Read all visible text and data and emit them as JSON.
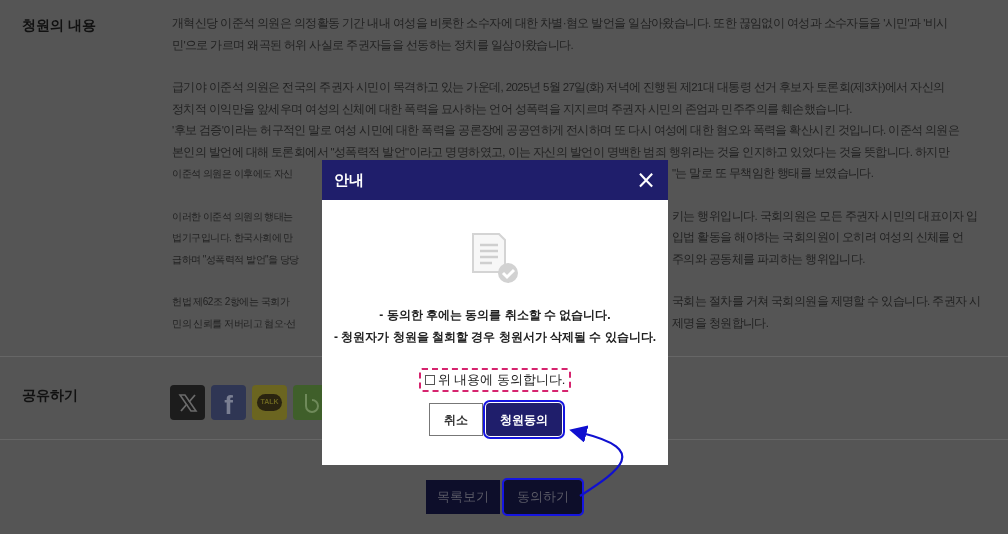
{
  "content_section": {
    "label": "청원의 내용",
    "paragraphs": [
      {
        "lines": [
          {
            "kind": "full",
            "text": "개혁신당 이준석 의원은 의정활동 기간 내내 여성을 비롯한 소수자에 대한 차별·혐오 발언을 일삼아왔습니다. 또한 끊임없이 여성과 소수자들을 '시민'과 '비시"
          },
          {
            "kind": "full",
            "text": "민'으로 가르며 왜곡된 허위 사실로 주권자들을 선동하는 정치를 일삼아왔습니다."
          }
        ]
      },
      {
        "lines": [
          {
            "kind": "full",
            "text": "급기야 이준석 의원은 전국의 주권자 시민이 목격하고 있는 가운데, 2025년 5월 27일(화) 저녁에 진행된 제21대 대통령 선거 후보자 토론회(제3차)에서 자신의"
          },
          {
            "kind": "full",
            "text": "정치적 이익만을 앞세우며 여성의 신체에 대한 폭력을 묘사하는  언어 성폭력을 지지르며 주권자 시민의 존엄과 민주주의를 훼손했습니다."
          },
          {
            "kind": "full",
            "text": "'후보 검증'이라는 허구적인 말로 여성 시민에 대한 폭력을 공론장에 공공연하게 전시하며 또 다시 여성에 대한 혐오와 폭력을 확산시킨 것입니다. 이준석 의원은"
          },
          {
            "kind": "full",
            "text": "본인의 발언에 대해 토론회에서 \"성폭력적 발언\"이라고 명명하였고, 이는 자신의 발언이 명백한 범죄 행위라는 것을 인지하고 있었다는 것을 뜻합니다. 하지만"
          },
          {
            "kind": "split",
            "left": "이준석 의원은 이후에도 자신",
            "right": "\"는 말로 또 무책임한 행태를 보였습니다."
          }
        ]
      },
      {
        "lines": [
          {
            "kind": "split",
            "left": "이러한 이준석 의원의 행태는",
            "right": "키는 행위입니다. 국회의원은 모든 주권자 시민의 대표이자 입"
          },
          {
            "kind": "split",
            "left": "법기구입니다. 한국사회에 만",
            "right": "입법 활동을 해야하는 국회의원이 오히려 여성의 신체를 언"
          },
          {
            "kind": "split",
            "left": "급하며 \"성폭력적 발언\"을 당당",
            "right": "주의와 공동체를 파괴하는 행위입니다."
          }
        ]
      },
      {
        "lines": [
          {
            "kind": "split",
            "left": "헌법 제62조 2항에는 국회가",
            "right": "국회는 절차를 거쳐 국회의원을 제명할 수 있습니다. 주권자 시"
          },
          {
            "kind": "split",
            "left": "민의 신뢰를 저버리고 혐오·선",
            "right": "제명을 청원합니다."
          }
        ]
      }
    ]
  },
  "share_section": {
    "label": "공유하기",
    "services": [
      {
        "kind": "x"
      },
      {
        "kind": "facebook",
        "text": "f"
      },
      {
        "kind": "kakaotalk",
        "text": "TALK"
      },
      {
        "kind": "band"
      }
    ]
  },
  "footer_buttons": [
    {
      "label": "목록보기",
      "highlighted": false
    },
    {
      "label": "동의하기",
      "highlighted": true
    }
  ],
  "dialog": {
    "title": "안내",
    "close": "×",
    "notices": [
      "- 동의한 후에는 동의를 취소할 수 없습니다.",
      "- 청원자가 청원을 철회할 경우 청원서가 삭제될 수 있습니다."
    ],
    "agree_checkbox": {
      "label": "위 내용에 동의합니다.",
      "checked": false,
      "highlighted": true
    },
    "buttons": [
      {
        "label": "취소",
        "kind": "secondary",
        "highlighted": false
      },
      {
        "label": "청원동의",
        "kind": "primary",
        "highlighted": true
      }
    ]
  },
  "annotation": {
    "arrow": true
  }
}
